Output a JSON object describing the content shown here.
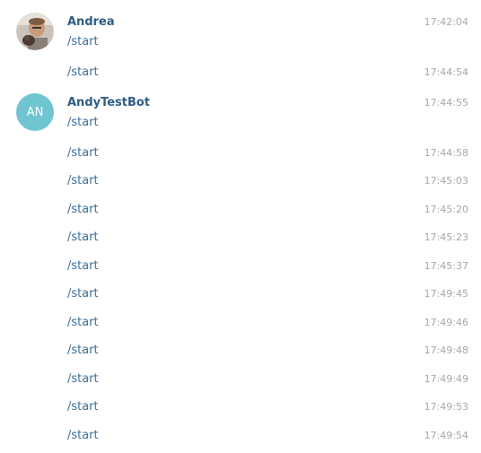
{
  "groups": [
    {
      "author": "Andrea",
      "avatar_type": "photo",
      "messages": [
        {
          "text": "/start",
          "time": "17:42:04"
        },
        {
          "text": "/start",
          "time": "17:44:54"
        }
      ]
    },
    {
      "author": "AndyTestBot",
      "avatar_type": "initials",
      "avatar_initials": "AN",
      "avatar_color": "#6fc6d0",
      "messages": [
        {
          "text": "/start",
          "time": "17:44:55"
        },
        {
          "text": "/start",
          "time": "17:44:58"
        },
        {
          "text": "/start",
          "time": "17:45:03"
        },
        {
          "text": "/start",
          "time": "17:45:20"
        },
        {
          "text": "/start",
          "time": "17:45:23"
        },
        {
          "text": "/start",
          "time": "17:45:37"
        },
        {
          "text": "/start",
          "time": "17:49:45"
        },
        {
          "text": "/start",
          "time": "17:49:46"
        },
        {
          "text": "/start",
          "time": "17:49:48"
        },
        {
          "text": "/start",
          "time": "17:49:49"
        },
        {
          "text": "/start",
          "time": "17:49:53"
        },
        {
          "text": "/start",
          "time": "17:49:54"
        }
      ]
    }
  ],
  "colors": {
    "author": "#2e5c85",
    "message_text": "#3a6c97",
    "timestamp": "#a7a7a7",
    "bot_avatar": "#6fc6d0"
  }
}
